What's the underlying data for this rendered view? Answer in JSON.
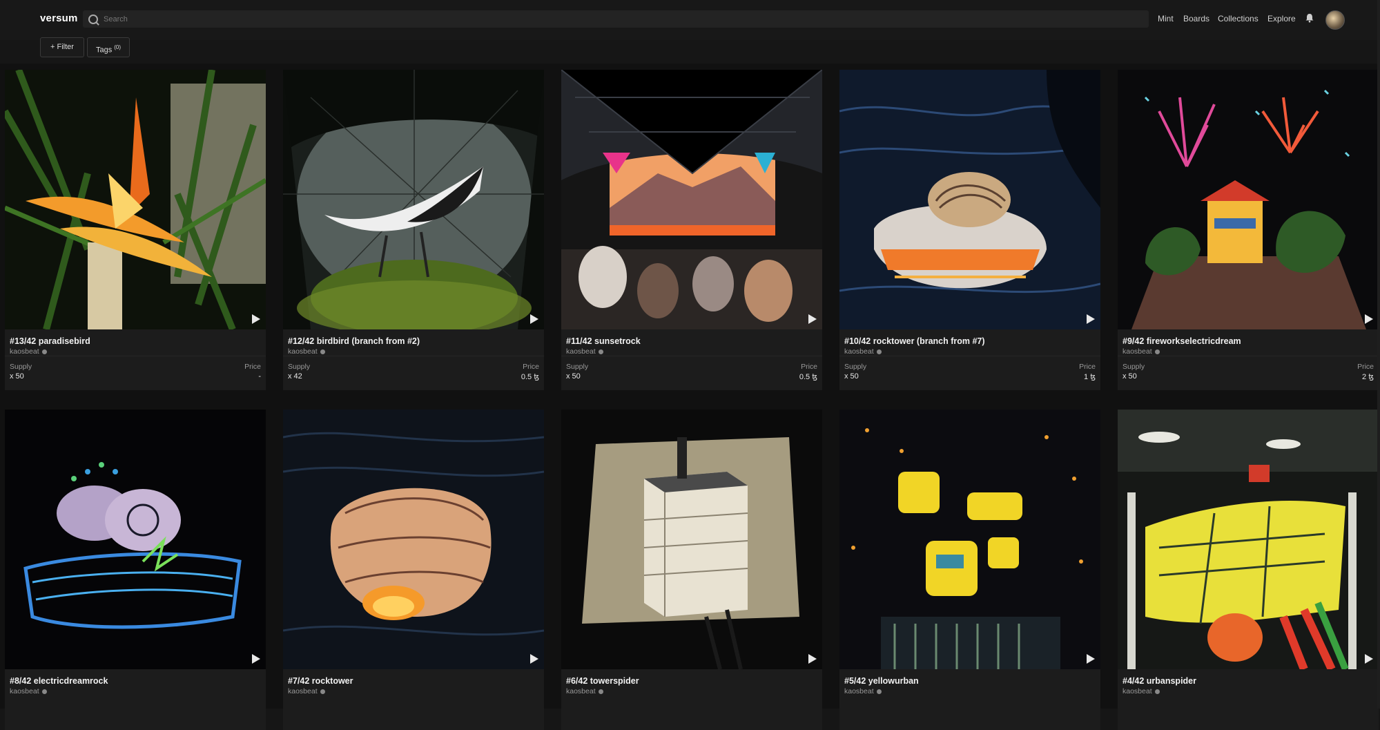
{
  "app": {
    "logo": "versum"
  },
  "search": {
    "placeholder": "Search"
  },
  "nav": [
    "Mint",
    "Boards",
    "Collections",
    "Explore"
  ],
  "filters": {
    "filter_label": "+ Filter",
    "tags_label": "Tags",
    "tags_count": "(0)"
  },
  "colors": {
    "background": "#111111",
    "card": "#1c1c1c",
    "text": "#f2f2f2",
    "muted": "#999999"
  },
  "icons": {
    "search": "search-icon",
    "bell": "bell-icon",
    "play": "play-icon",
    "verified": "verified-icon"
  },
  "supply_label": "Supply",
  "price_label": "Price",
  "cards": [
    {
      "title": "#13/42 paradisebird",
      "artist": "kaosbeat",
      "supply": "x 50",
      "price": "-"
    },
    {
      "title": "#12/42 birdbird (branch from #2)",
      "artist": "kaosbeat",
      "supply": "x 42",
      "price": "0.5 ꜩ"
    },
    {
      "title": "#11/42 sunsetrock",
      "artist": "kaosbeat",
      "supply": "x 50",
      "price": "0.5 ꜩ"
    },
    {
      "title": "#10/42 rocktower (branch from #7)",
      "artist": "kaosbeat",
      "supply": "x 50",
      "price": "1 ꜩ"
    },
    {
      "title": "#9/42 fireworkselectricdream",
      "artist": "kaosbeat",
      "supply": "x 50",
      "price": "2 ꜩ"
    },
    {
      "title": "#8/42 electricdreamrock",
      "artist": "kaosbeat",
      "supply": "",
      "price": ""
    },
    {
      "title": "#7/42 rocktower",
      "artist": "kaosbeat",
      "supply": "",
      "price": ""
    },
    {
      "title": "#6/42 towerspider",
      "artist": "kaosbeat",
      "supply": "",
      "price": ""
    },
    {
      "title": "#5/42 yellowurban",
      "artist": "kaosbeat",
      "supply": "",
      "price": ""
    },
    {
      "title": "#4/42 urbanspider",
      "artist": "kaosbeat",
      "supply": "",
      "price": ""
    }
  ]
}
